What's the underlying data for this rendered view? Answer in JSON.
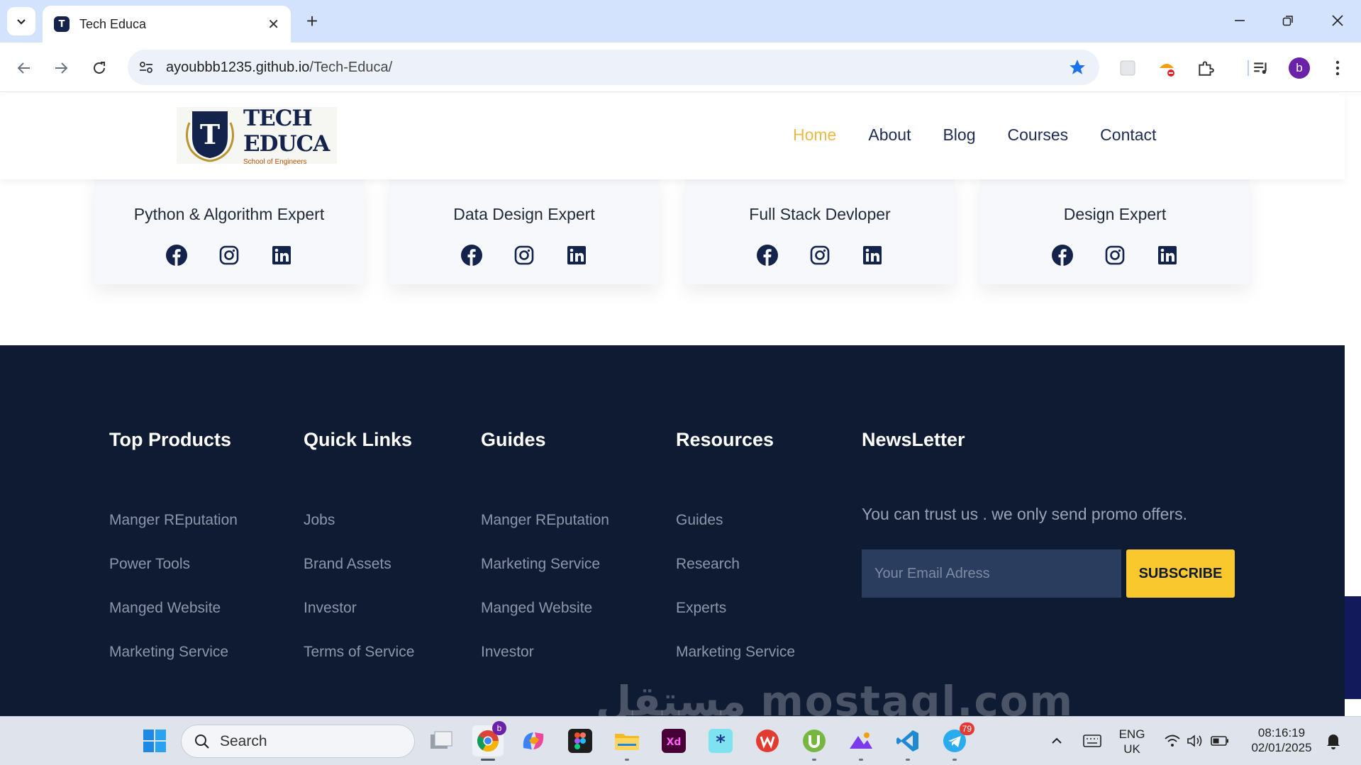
{
  "browser": {
    "tab_title": "Tech Educa",
    "url_host": "ayoubbb1235.github.io",
    "url_path": "/Tech-Educa/",
    "profile_initial": "b"
  },
  "site": {
    "logo_line1": "TECH",
    "logo_line2": "EDUCA",
    "logo_tagline": "School of Engineers",
    "logo_letter": "T",
    "nav": [
      {
        "label": "Home",
        "active": true
      },
      {
        "label": "About"
      },
      {
        "label": "Blog"
      },
      {
        "label": "Courses"
      },
      {
        "label": "Contact"
      }
    ],
    "accent_color": "#ebb94a",
    "brand_color": "#14234b"
  },
  "team_cards": [
    {
      "title": "Python & Algorithm Expert"
    },
    {
      "title": "Data Design Expert"
    },
    {
      "title": "Full Stack Devloper"
    },
    {
      "title": "Design Expert"
    }
  ],
  "footer": {
    "columns": [
      {
        "heading": "Top Products",
        "links": [
          "Manger REputation",
          "Power Tools",
          "Manged Website",
          "Marketing Service"
        ]
      },
      {
        "heading": "Quick Links",
        "links": [
          "Jobs",
          "Brand Assets",
          "Investor",
          "Terms of Service"
        ]
      },
      {
        "heading": "Guides",
        "links": [
          "Manger REputation",
          "Marketing Service",
          "Manged Website",
          "Investor"
        ]
      },
      {
        "heading": "Resources",
        "links": [
          "Guides",
          "Research",
          "Experts",
          "Marketing Service"
        ]
      }
    ],
    "newsletter": {
      "heading": "NewsLetter",
      "text": "You can trust us . we only send promo offers.",
      "placeholder": "Your Email Adress",
      "button": "SUBSCRIBE"
    },
    "watermark": "مستقل mostaql.com"
  },
  "taskbar": {
    "search_label": "Search",
    "lang_line1": "ENG",
    "lang_line2": "UK",
    "time": "08:16:19",
    "date": "02/01/2025",
    "telegram_badge": "79",
    "chrome_badge": "b"
  }
}
